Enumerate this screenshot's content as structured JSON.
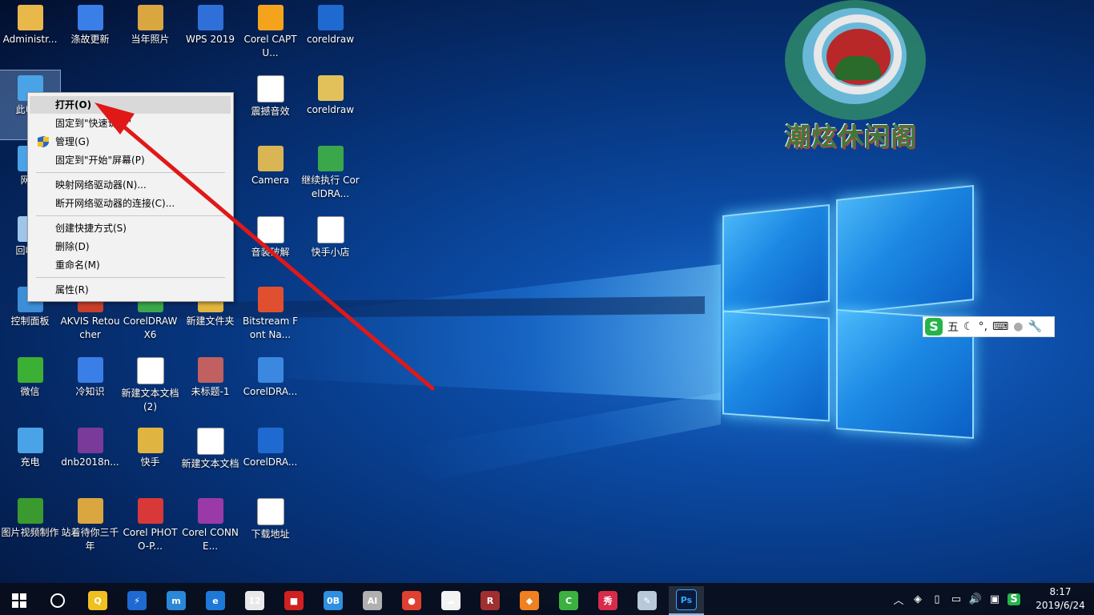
{
  "desktop": {
    "icons": [
      {
        "label": "Administr...",
        "icon": "user-folder-icon",
        "color": "#e8b84a"
      },
      {
        "label": "涤故更新",
        "icon": "wps-doc-icon",
        "color": "#3a7ee8"
      },
      {
        "label": "当年照片",
        "icon": "folder-icon",
        "color": "#d9a640"
      },
      {
        "label": "WPS 2019",
        "icon": "wps-icon",
        "color": "#2f6fd8"
      },
      {
        "label": "Corel CAPTU...",
        "icon": "corel-capture-icon",
        "color": "#f3a41c"
      },
      {
        "label": "coreldraw",
        "icon": "zip-icon",
        "color": "#1e6ad0"
      },
      {
        "label": "此电脑",
        "icon": "this-pc-icon",
        "color": "#4aa3e6"
      },
      {
        "label": "震撼音效",
        "icon": "audio-file-icon",
        "color": "#ffffff"
      },
      {
        "label": "coreldraw",
        "icon": "folder-icon",
        "color": "#e3c15a"
      },
      {
        "label": "网络",
        "icon": "network-icon",
        "color": "#4aa3e6"
      },
      {
        "label": "Camera",
        "icon": "folder-icon",
        "color": "#d9b553"
      },
      {
        "label": "继续执行 CorelDRA...",
        "icon": "balloon-icon",
        "color": "#3aa84a"
      },
      {
        "label": "回收站",
        "icon": "recycle-bin-icon",
        "color": "#9fc6e8"
      },
      {
        "label": "音装破解",
        "icon": "text-file-icon",
        "color": "#ffffff"
      },
      {
        "label": "快手小店",
        "icon": "text-file-icon",
        "color": "#ffffff"
      },
      {
        "label": "控制面板",
        "icon": "control-panel-icon",
        "color": "#3c8ed8"
      },
      {
        "label": "AKVIS Retoucher",
        "icon": "akvis-icon",
        "color": "#c8402a"
      },
      {
        "label": "CorelDRAW X6",
        "icon": "coreldraw-icon",
        "color": "#3aa84a"
      },
      {
        "label": "新建文件夹",
        "icon": "folder-icon",
        "color": "#e0b440"
      },
      {
        "label": "Bitstream Font Na...",
        "icon": "bitstream-icon",
        "color": "#e05030"
      },
      {
        "label": "微信",
        "icon": "wechat-icon",
        "color": "#3cb034"
      },
      {
        "label": "冷知识",
        "icon": "wps-doc-icon",
        "color": "#3a7ee8"
      },
      {
        "label": "新建文本文档 (2)",
        "icon": "text-file-icon",
        "color": "#ffffff"
      },
      {
        "label": "未标题-1",
        "icon": "image-file-icon",
        "color": "#c06060"
      },
      {
        "label": "CorelDRA...",
        "icon": "balloon-icon",
        "color": "#3a88e0"
      },
      {
        "label": "充电",
        "icon": "folder-pc-icon",
        "color": "#4aa3e6"
      },
      {
        "label": "dnb2018n...",
        "icon": "rar-icon",
        "color": "#7a3a9a"
      },
      {
        "label": "快手",
        "icon": "folder-icon",
        "color": "#e0b440"
      },
      {
        "label": "新建文本文档",
        "icon": "text-file-icon",
        "color": "#ffffff"
      },
      {
        "label": "CorelDRA...",
        "icon": "zip-icon",
        "color": "#1e6ad0"
      },
      {
        "label": "图片视频制作",
        "icon": "tree-icon",
        "color": "#3a9a30"
      },
      {
        "label": "站着待你三千年",
        "icon": "folder-icon",
        "color": "#d9a640"
      },
      {
        "label": "Corel PHOTO-P...",
        "icon": "corel-photo-icon",
        "color": "#d83838"
      },
      {
        "label": "Corel CONNE...",
        "icon": "corel-connect-icon",
        "color": "#9a3aa8"
      },
      {
        "label": "下载地址",
        "icon": "text-file-icon",
        "color": "#ffffff"
      }
    ]
  },
  "context_menu": {
    "items": [
      {
        "label": "打开(O)",
        "highlight": true
      },
      {
        "label": "固定到\"快速访问\""
      },
      {
        "label": "管理(G)",
        "icon": "shield-icon"
      },
      {
        "label": "固定到\"开始\"屏幕(P)"
      },
      {
        "sep": true
      },
      {
        "label": "映射网络驱动器(N)..."
      },
      {
        "label": "断开网络驱动器的连接(C)..."
      },
      {
        "sep": true
      },
      {
        "label": "创建快捷方式(S)"
      },
      {
        "label": "删除(D)"
      },
      {
        "label": "重命名(M)"
      },
      {
        "sep": true
      },
      {
        "label": "属性(R)"
      }
    ]
  },
  "watermark": {
    "text": "潮炫休闲阁"
  },
  "ime_bar": {
    "logo": "S",
    "mode": "五",
    "items": [
      "moon-icon",
      "punctuation-icon",
      "keyboard-icon",
      "user-icon",
      "wrench-icon"
    ]
  },
  "taskbar": {
    "apps": [
      {
        "name": "qq-icon",
        "color": "#f0c020",
        "glyph": "Q"
      },
      {
        "name": "corel-app-icon",
        "color": "#1e6ad0",
        "glyph": "⚡"
      },
      {
        "name": "maxthon-icon",
        "color": "#2a88d8",
        "glyph": "m"
      },
      {
        "name": "edge-icon",
        "color": "#1e78d8",
        "glyph": "e"
      },
      {
        "name": "calculator-icon",
        "color": "#e8e8e8",
        "glyph": "12"
      },
      {
        "name": "color-app-icon",
        "color": "#d02020",
        "glyph": "■"
      },
      {
        "name": "ob-icon",
        "color": "#2f8fe0",
        "glyph": "0B"
      },
      {
        "name": "ai-app-icon",
        "color": "#b0b0b0",
        "glyph": "AI"
      },
      {
        "name": "chrome-icon",
        "color": "#e04030",
        "glyph": "●"
      },
      {
        "name": "baidu-netdisk-icon",
        "color": "#f2f2f2",
        "glyph": "☁"
      },
      {
        "name": "winrar-icon",
        "color": "#a03030",
        "glyph": "R"
      },
      {
        "name": "fish-app-icon",
        "color": "#f08020",
        "glyph": "◆"
      },
      {
        "name": "camtasia-icon",
        "color": "#3cb040",
        "glyph": "C"
      },
      {
        "name": "meitu-icon",
        "color": "#d82a4a",
        "glyph": "秀"
      },
      {
        "name": "paint-icon",
        "color": "#b8c8d8",
        "glyph": "✎"
      },
      {
        "name": "photoshop-icon",
        "color": "#0a1a3a",
        "glyph": "Ps",
        "active": true
      }
    ],
    "tray": [
      "chevron-up-icon",
      "box-icon",
      "usb-icon",
      "battery-icon",
      "volume-icon",
      "network-icon",
      "sogou-icon"
    ],
    "time": "8:17",
    "date": "2019/6/24"
  }
}
